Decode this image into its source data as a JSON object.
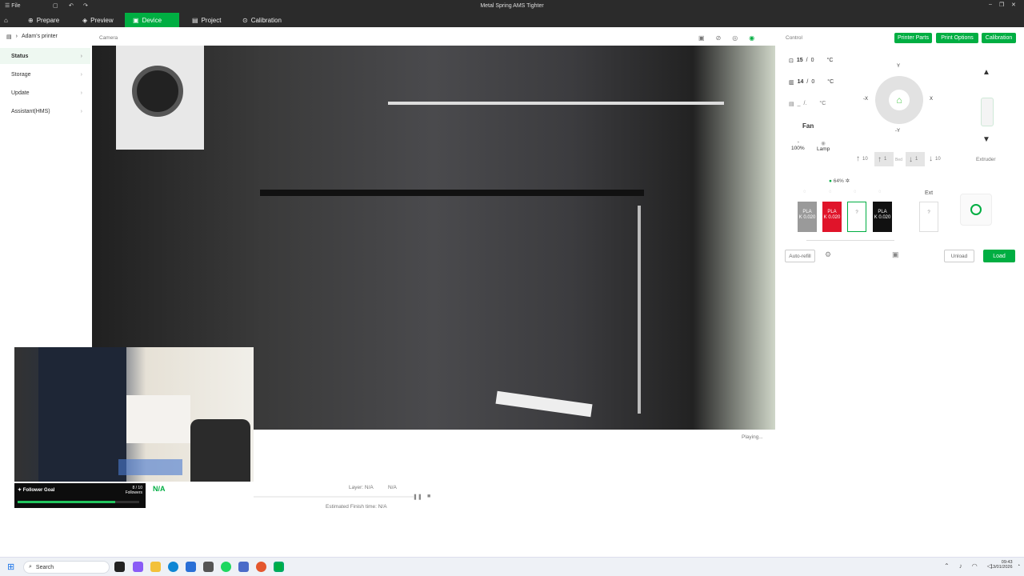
{
  "titlebar": {
    "file_label": "File",
    "title": "Metal Spring AMS Tighter"
  },
  "menubar": {
    "tabs": [
      {
        "label": "Prepare"
      },
      {
        "label": "Preview"
      },
      {
        "label": "Device"
      },
      {
        "label": "Project"
      },
      {
        "label": "Calibration"
      }
    ]
  },
  "sidebar": {
    "printer_name": "Adam's printer",
    "items": [
      {
        "label": "Status"
      },
      {
        "label": "Storage"
      },
      {
        "label": "Update"
      },
      {
        "label": "Assistant(HMS)"
      }
    ]
  },
  "camera": {
    "label": "Camera",
    "status": "Playing..."
  },
  "print": {
    "name": "N/A",
    "layer_label": "Layer: N/A",
    "layer_value": "N/A",
    "finish": "Estimated Finish time: N/A"
  },
  "follower_goal": {
    "label": "Follower Goal",
    "count": "8 / 10",
    "unit": "Followers",
    "progress": 0.8
  },
  "control": {
    "label": "Control",
    "buttons": {
      "parts": "Printer Parts",
      "options": "Print Options",
      "calibration": "Calibration"
    },
    "temps": [
      {
        "cur": "15",
        "target": "0",
        "unit": "°C"
      },
      {
        "cur": "14",
        "target": "0",
        "unit": "°C"
      },
      {
        "cur": "_",
        "target": "/.",
        "unit": "°C"
      }
    ],
    "fan_label": "Fan",
    "speed_value": "100%",
    "lamp_label": "Lamp",
    "jog": {
      "y_plus": "Y",
      "y_minus": "-Y",
      "x_minus": "-X",
      "x_plus": "X"
    },
    "bed": {
      "up10": "10",
      "up1": "1",
      "label": "Bed",
      "down1": "1",
      "down10": "10"
    },
    "extruder_label": "Extruder",
    "humidity": "64%",
    "ext_label": "Ext",
    "spools": [
      {
        "type": "PLA",
        "sub": "K 0.020",
        "color": "#9a9a9a"
      },
      {
        "type": "PLA",
        "sub": "K 0.020",
        "color": "#e0142a"
      },
      {
        "type": "?",
        "sub": "",
        "color": "#ffffff"
      },
      {
        "type": "PLA",
        "sub": "K 0.020",
        "color": "#111111"
      }
    ],
    "ext_spool": "?",
    "auto_refill": "Auto-refill",
    "unload": "Unload",
    "load": "Load"
  },
  "taskbar": {
    "search": "Search",
    "time": "09:43",
    "date": "13/01/2026"
  }
}
